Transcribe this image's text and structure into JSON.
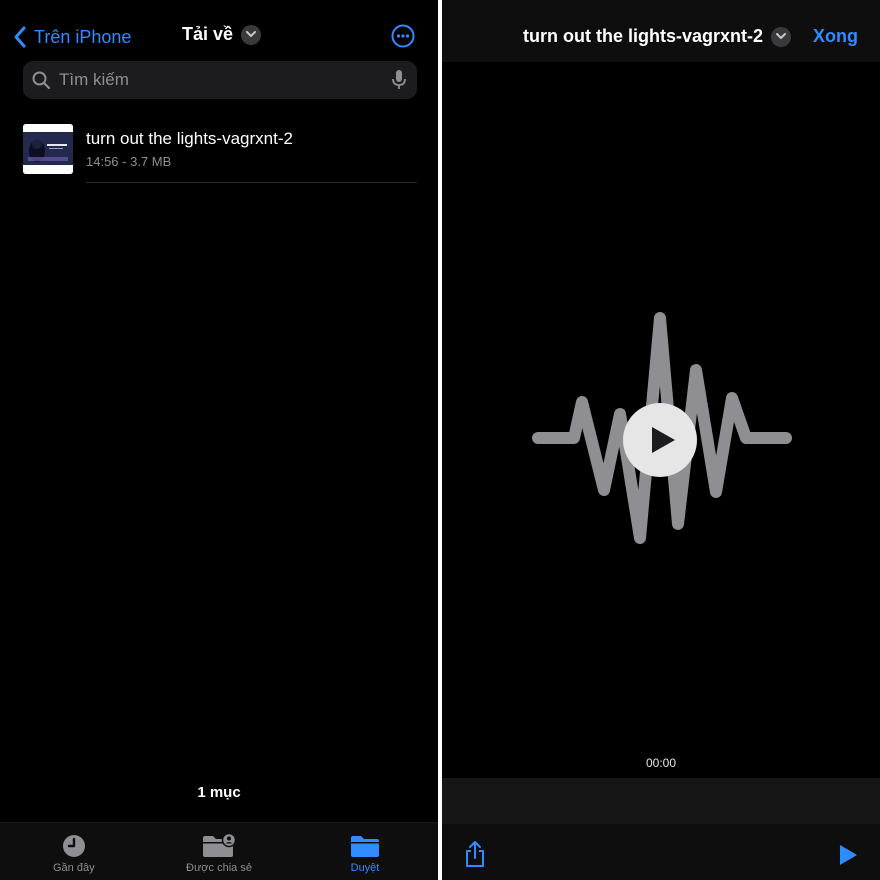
{
  "left": {
    "back_label": "Trên iPhone",
    "folder_title": "Tải về",
    "search": {
      "placeholder": "Tìm kiếm"
    },
    "files": [
      {
        "name": "turn out the lights-vagrxnt-2",
        "meta": "14:56 - 3.7 MB"
      }
    ],
    "item_count": "1 mục",
    "tabs": [
      {
        "label": "Gần đây",
        "icon": "clock-icon"
      },
      {
        "label": "Được chia sẻ",
        "icon": "shared-folder-icon"
      },
      {
        "label": "Duyệt",
        "icon": "folder-icon",
        "active": true
      }
    ]
  },
  "right": {
    "title": "turn out the lights-vagrxnt-2",
    "done_label": "Xong",
    "current_time": "00:00"
  },
  "colors": {
    "accent": "#2f8cff",
    "background": "#000000",
    "secondary_text": "#8e8e93",
    "waveform": "#8e8e93"
  }
}
